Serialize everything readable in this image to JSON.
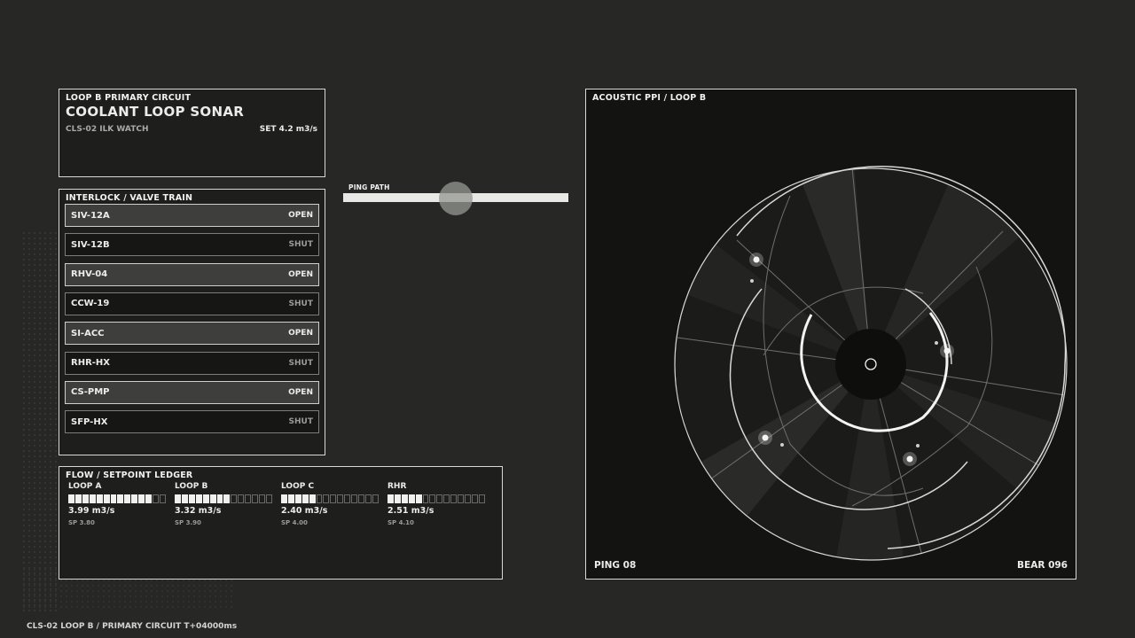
{
  "header": {
    "eyebrow": "LOOP B  PRIMARY CIRCUIT",
    "title": "COOLANT LOOP SONAR",
    "meta": "CLS-02   ILK WATCH",
    "setpoint": "SET  4.2 m3/s"
  },
  "valves": {
    "title": "INTERLOCK / VALVE TRAIN",
    "items": [
      {
        "id": "SIV-12A",
        "state": "OPEN"
      },
      {
        "id": "SIV-12B",
        "state": "SHUT"
      },
      {
        "id": "RHV-04",
        "state": "OPEN"
      },
      {
        "id": "CCW-19",
        "state": "SHUT"
      },
      {
        "id": "SI-ACC",
        "state": "OPEN"
      },
      {
        "id": "RHR-HX",
        "state": "SHUT"
      },
      {
        "id": "CS-PMP",
        "state": "OPEN"
      },
      {
        "id": "SFP-HX",
        "state": "SHUT"
      }
    ]
  },
  "ledger": {
    "title": "FLOW / SETPOINT LEDGER",
    "segments_total": 14,
    "loops": [
      {
        "name": "LOOP A",
        "lit": 12,
        "value": "3.99 m3/s",
        "sp": "SP 3.80"
      },
      {
        "name": "LOOP B",
        "lit": 8,
        "value": "3.32 m3/s",
        "sp": "SP 3.90"
      },
      {
        "name": "LOOP C",
        "lit": 5,
        "value": "2.40 m3/s",
        "sp": "SP 4.00"
      },
      {
        "name": "RHR",
        "lit": 5,
        "value": "2.51 m3/s",
        "sp": "SP 4.10"
      }
    ]
  },
  "ping_path": {
    "label": "PING PATH",
    "position": 0.5
  },
  "ppi": {
    "title": "ACOUSTIC PPI  /  LOOP B",
    "ping": "PING 08",
    "bearing": "BEAR 096"
  },
  "footer": "CLS-02  LOOP B / PRIMARY CIRCUIT  T+04000ms"
}
